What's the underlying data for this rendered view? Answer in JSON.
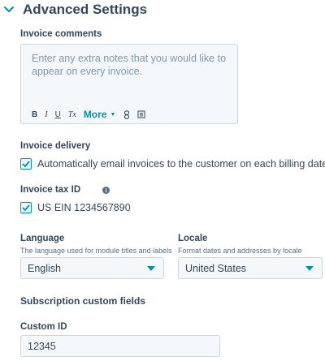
{
  "section": {
    "title": "Advanced Settings",
    "icon": "chevron-down-icon"
  },
  "invoice_comments": {
    "label": "Invoice comments",
    "placeholder": "Enter any extra notes that you would like to appear on every invoice.",
    "toolbar": {
      "bold": "B",
      "italic": "I",
      "underline": "U",
      "clear_format": "Tx",
      "more": "More",
      "link_icon": "link-icon",
      "insert_icon": "insert-icon"
    }
  },
  "invoice_delivery": {
    "label": "Invoice delivery",
    "checkbox_label": "Automatically email invoices to the customer on each billing date",
    "checked": true
  },
  "invoice_tax_id": {
    "label": "Invoice tax ID",
    "info_icon": "info-icon",
    "checkbox_label": "US EIN 1234567890",
    "checked": true
  },
  "language": {
    "label": "Language",
    "help": "The language used for module titles and labels",
    "value": "English"
  },
  "locale": {
    "label": "Locale",
    "help": "Format dates and addresses by locale",
    "value": "United States"
  },
  "custom_fields": {
    "heading": "Subscription custom fields",
    "custom_id_label": "Custom ID",
    "custom_id_value": "12345"
  },
  "colors": {
    "accent": "#0091ae",
    "text": "#33475b",
    "field_bg": "#f5f8fa",
    "border": "#cbd6e2"
  }
}
